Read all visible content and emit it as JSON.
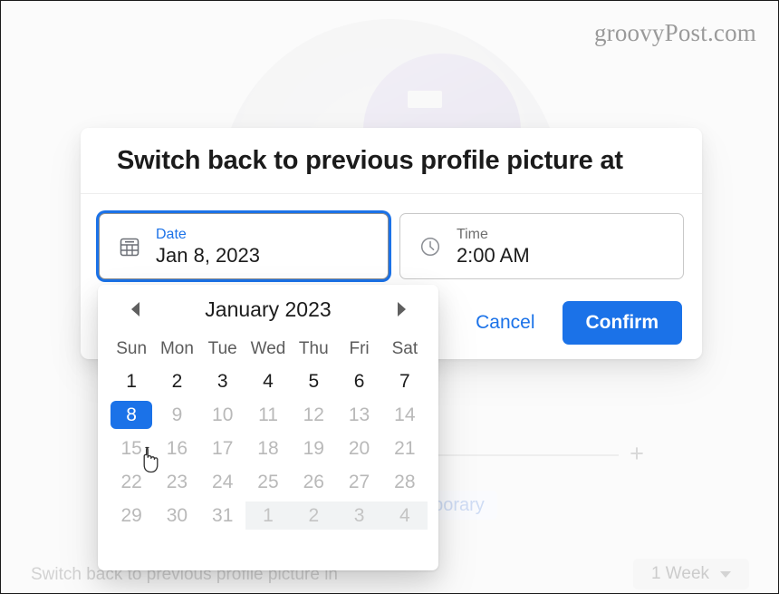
{
  "background": {
    "watermark": "groovyPost.com",
    "make_temporary_label": "ke Temporary",
    "bottom_label": "Switch back to previous profile picture in",
    "duration_dropdown_value": "1 Week",
    "add_icon": "+",
    "profile_photo_alt": "football player in purple helmet"
  },
  "dialog": {
    "title": "Switch back to previous profile picture at",
    "date_field": {
      "label": "Date",
      "value": "Jan 8, 2023",
      "icon": "calendar-icon"
    },
    "time_field": {
      "label": "Time",
      "value": "2:00 AM",
      "icon": "clock-icon"
    },
    "cancel_label": "Cancel",
    "confirm_label": "Confirm"
  },
  "calendar": {
    "month_title": "January 2023",
    "prev_icon": "chevron-left-icon",
    "next_icon": "chevron-right-icon",
    "weekdays": [
      "Sun",
      "Mon",
      "Tue",
      "Wed",
      "Thu",
      "Fri",
      "Sat"
    ],
    "days": [
      {
        "label": "1",
        "state": "enabled"
      },
      {
        "label": "2",
        "state": "enabled"
      },
      {
        "label": "3",
        "state": "enabled"
      },
      {
        "label": "4",
        "state": "enabled"
      },
      {
        "label": "5",
        "state": "enabled"
      },
      {
        "label": "6",
        "state": "enabled"
      },
      {
        "label": "7",
        "state": "enabled"
      },
      {
        "label": "8",
        "state": "selected"
      },
      {
        "label": "9",
        "state": "disabled"
      },
      {
        "label": "10",
        "state": "disabled"
      },
      {
        "label": "11",
        "state": "disabled"
      },
      {
        "label": "12",
        "state": "disabled"
      },
      {
        "label": "13",
        "state": "disabled"
      },
      {
        "label": "14",
        "state": "disabled"
      },
      {
        "label": "15",
        "state": "disabled"
      },
      {
        "label": "16",
        "state": "disabled"
      },
      {
        "label": "17",
        "state": "disabled"
      },
      {
        "label": "18",
        "state": "disabled"
      },
      {
        "label": "19",
        "state": "disabled"
      },
      {
        "label": "20",
        "state": "disabled"
      },
      {
        "label": "21",
        "state": "disabled"
      },
      {
        "label": "22",
        "state": "disabled"
      },
      {
        "label": "23",
        "state": "disabled"
      },
      {
        "label": "24",
        "state": "disabled"
      },
      {
        "label": "25",
        "state": "disabled"
      },
      {
        "label": "26",
        "state": "disabled"
      },
      {
        "label": "27",
        "state": "disabled"
      },
      {
        "label": "28",
        "state": "disabled"
      },
      {
        "label": "29",
        "state": "disabled"
      },
      {
        "label": "30",
        "state": "disabled"
      },
      {
        "label": "31",
        "state": "disabled"
      },
      {
        "label": "1",
        "state": "othermonth"
      },
      {
        "label": "2",
        "state": "othermonth"
      },
      {
        "label": "3",
        "state": "othermonth"
      },
      {
        "label": "4",
        "state": "othermonth"
      }
    ]
  },
  "colors": {
    "accent_blue": "#1b72e8",
    "selected_day_bg": "#1b72e8",
    "dialog_bg": "#ffffff",
    "page_bg": "#fbfbfb",
    "disabled_text": "#b9b9b9",
    "othermonth_bg": "#f1f3f4"
  },
  "cursor": {
    "type": "pointer-hand-cursor"
  }
}
